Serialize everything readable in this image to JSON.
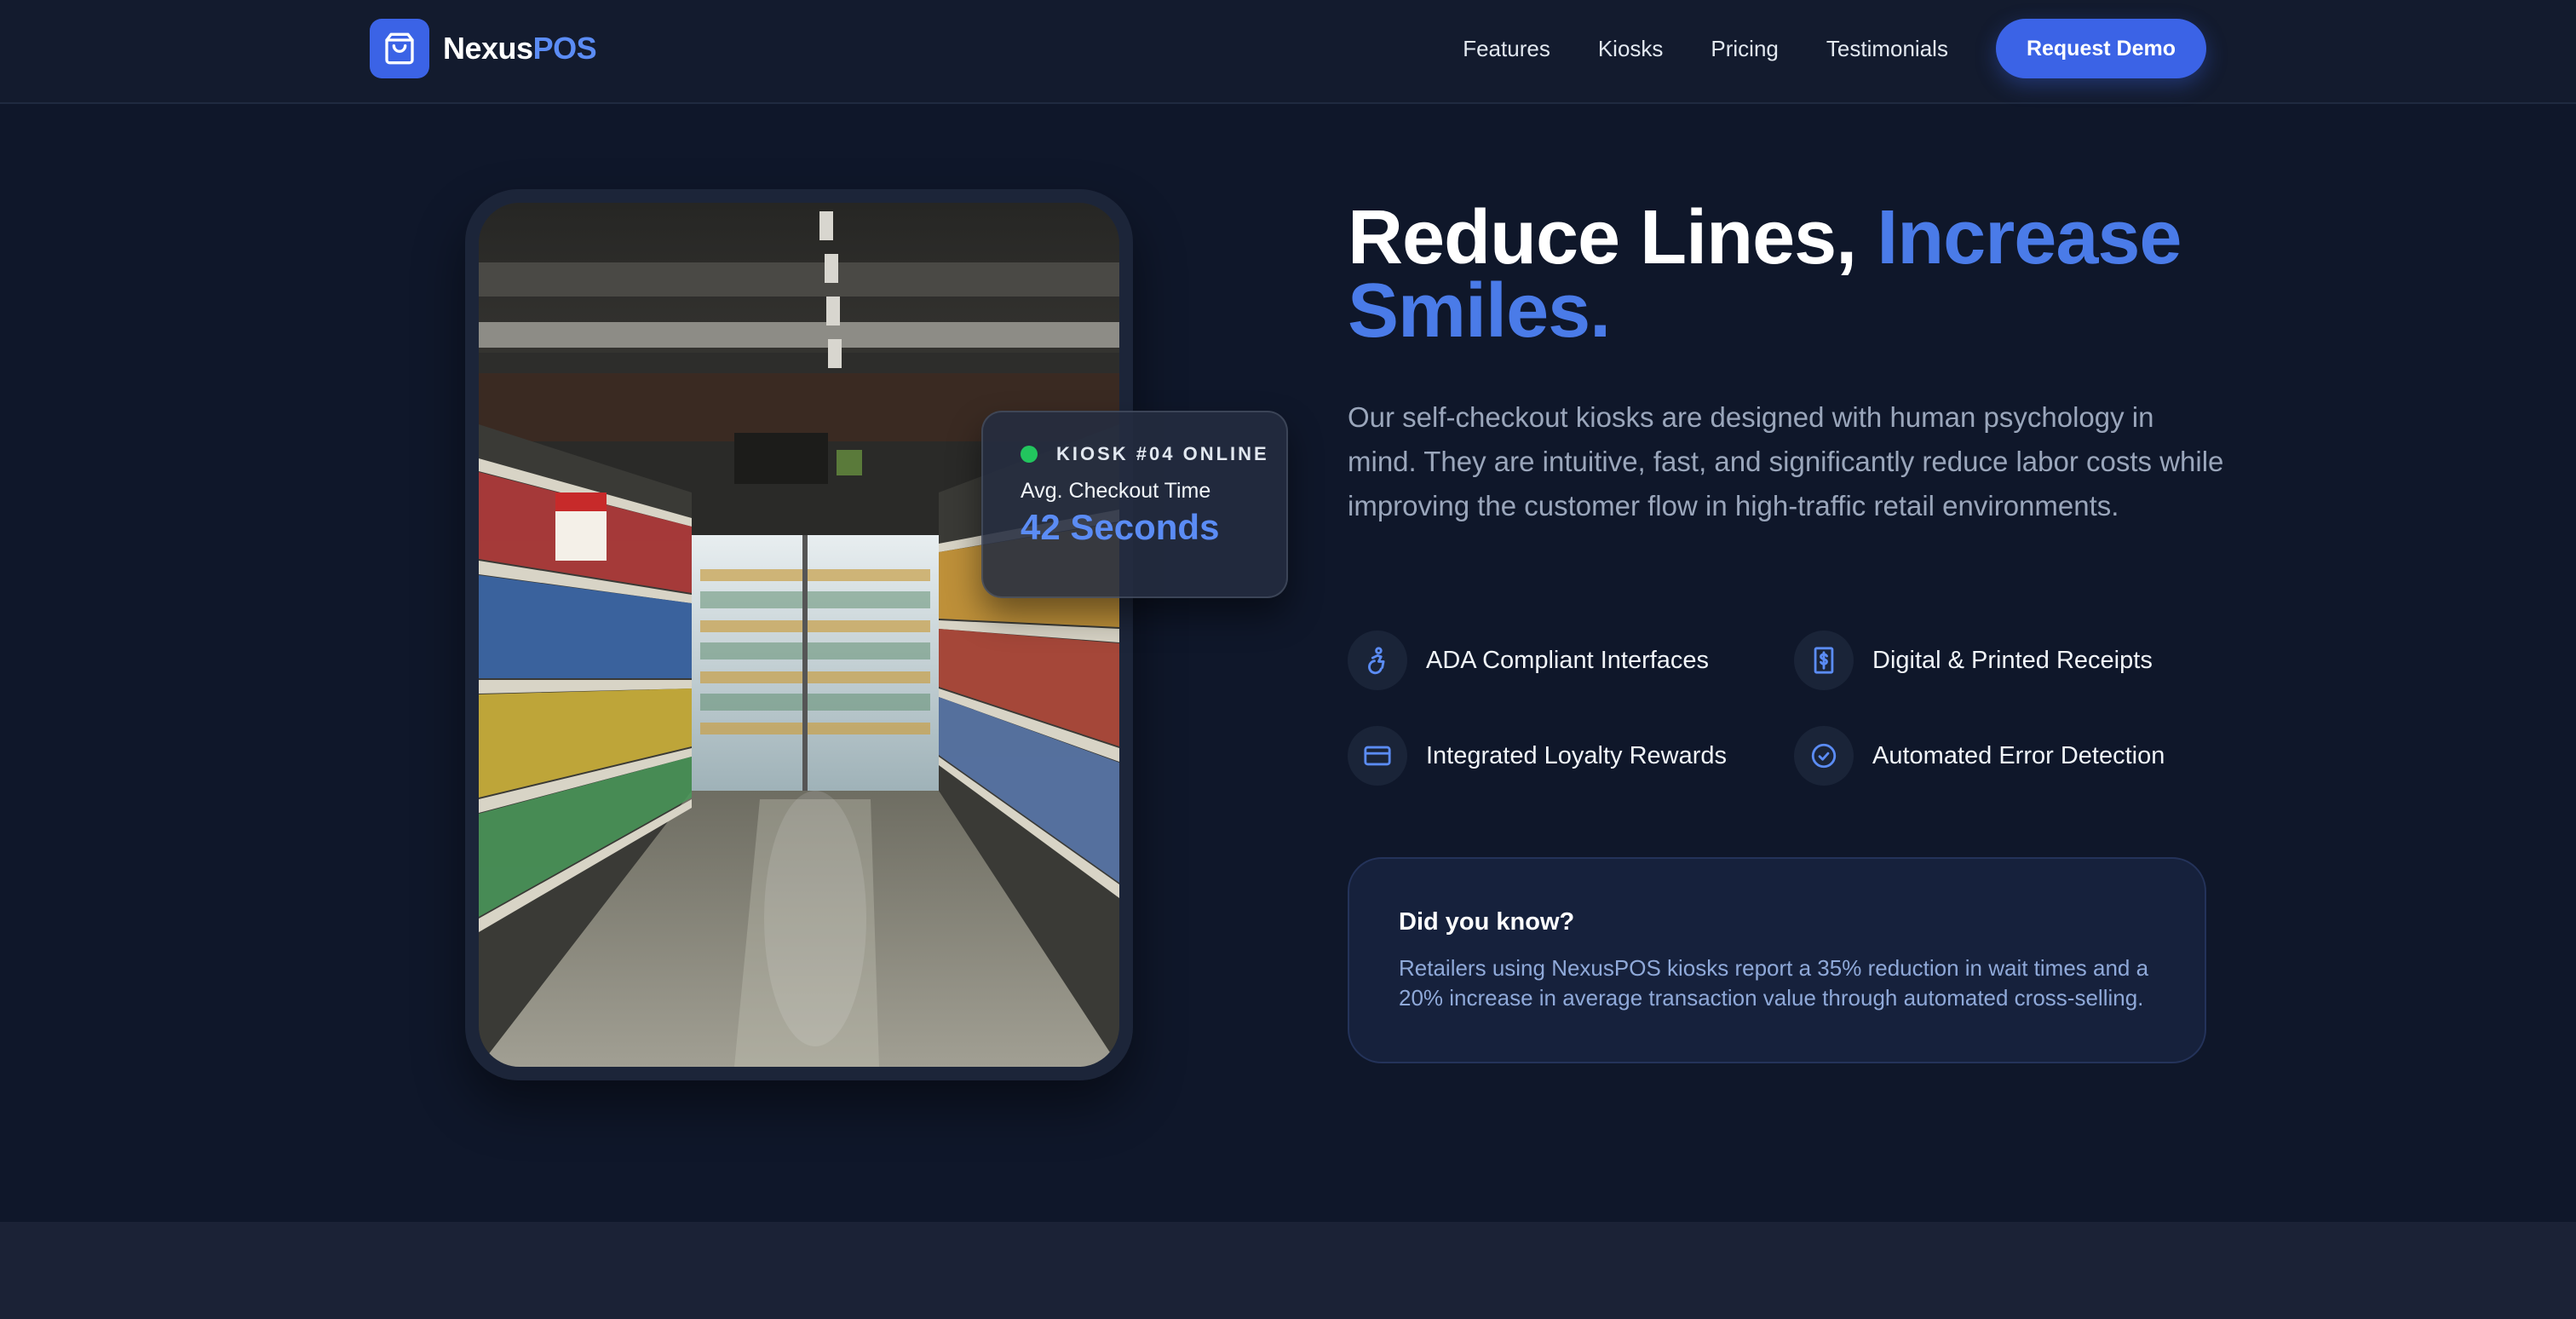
{
  "brand": {
    "name_part1": "Nexus",
    "name_part2": "POS"
  },
  "nav": {
    "items": [
      {
        "label": "Features"
      },
      {
        "label": "Kiosks"
      },
      {
        "label": "Pricing"
      },
      {
        "label": "Testimonials"
      }
    ],
    "cta_label": "Request Demo"
  },
  "hero": {
    "title_part1": "Reduce Lines,",
    "title_part2": "Increase Smiles.",
    "description": "Our self-checkout kiosks are designed with human psychology in mind. They are intuitive, fast, and significantly reduce labor costs while improving the customer flow in high-traffic retail environments."
  },
  "status_card": {
    "label": "KIOSK #04 ONLINE",
    "metric_label": "Avg. Checkout Time",
    "metric_value": "42 Seconds",
    "status_color": "#22c55e"
  },
  "features": [
    {
      "label": "ADA Compliant Interfaces",
      "icon": "accessibility-icon"
    },
    {
      "label": "Digital & Printed Receipts",
      "icon": "receipt-icon"
    },
    {
      "label": "Integrated Loyalty Rewards",
      "icon": "credit-card-icon"
    },
    {
      "label": "Automated Error Detection",
      "icon": "check-circle-icon"
    }
  ],
  "info": {
    "title": "Did you know?",
    "text": "Retailers using NexusPOS kiosks report a 35% reduction in wait times and a 20% increase in average transaction value through automated cross-selling."
  },
  "colors": {
    "accent": "#3b63e6",
    "accent_text": "#5b8cf5",
    "background": "#0f172a"
  }
}
